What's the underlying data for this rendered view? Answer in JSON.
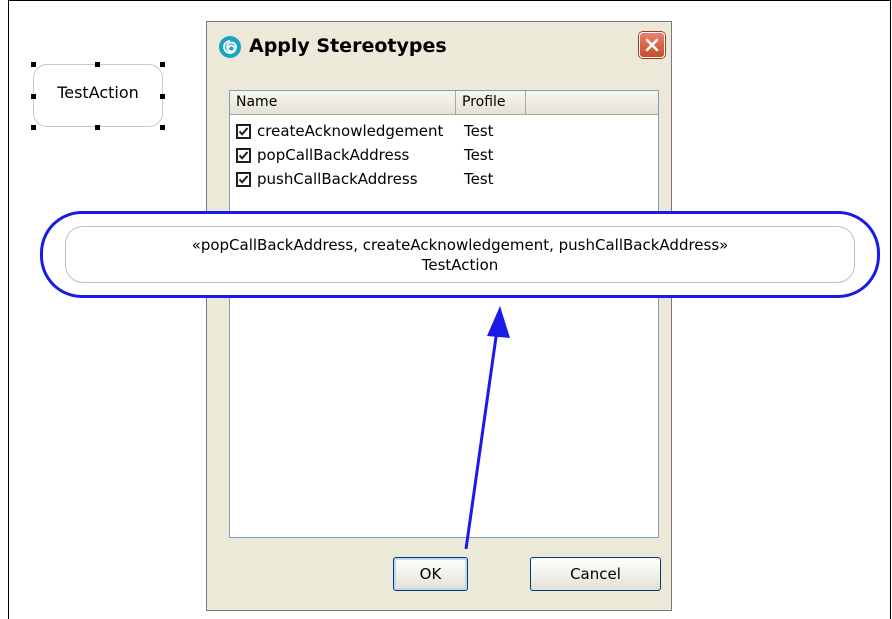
{
  "diagram": {
    "node_label": "TestAction"
  },
  "dialog": {
    "title": "Apply Stereotypes",
    "app_icon": "swirl-icon",
    "close_icon": "close-icon",
    "columns": [
      "Name",
      "Profile"
    ],
    "rows": [
      {
        "checked": true,
        "name": "createAcknowledgement",
        "profile": "Test"
      },
      {
        "checked": true,
        "name": "popCallBackAddress",
        "profile": "Test"
      },
      {
        "checked": true,
        "name": "pushCallBackAddress",
        "profile": "Test"
      }
    ],
    "ok_label": "OK",
    "cancel_label": "Cancel"
  },
  "callout": {
    "stereotypes_line": "«popCallBackAddress, createAcknowledgement, pushCallBackAddress»",
    "name_line": "TestAction",
    "accent_color": "#1a1ae6"
  }
}
